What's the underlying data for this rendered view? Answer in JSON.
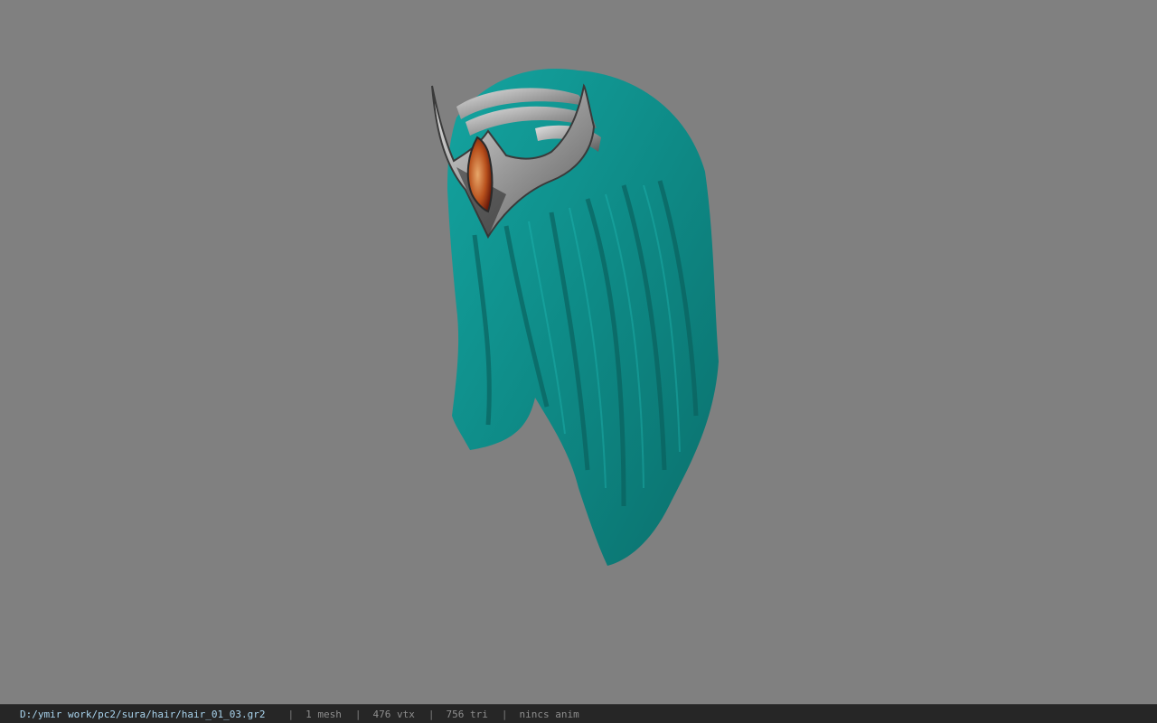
{
  "viewport": {
    "background_color": "#808080",
    "model": "hair-mesh",
    "hair_color": "#0f8a86",
    "ornament_color": "#b8b8b8",
    "gem_color": "#c0541c"
  },
  "statusbar": {
    "path": "D:/ymir work/pc2/sura/hair/hair_01_03.gr2",
    "separator": "|",
    "mesh": "1 mesh",
    "vtx": "476 vtx",
    "tri": "756 tri",
    "anim": "nincs anim"
  },
  "colors": {
    "statusbar_bg": "#262626",
    "path_text": "#a9d4ee",
    "stat_text": "#8e8e8e"
  }
}
